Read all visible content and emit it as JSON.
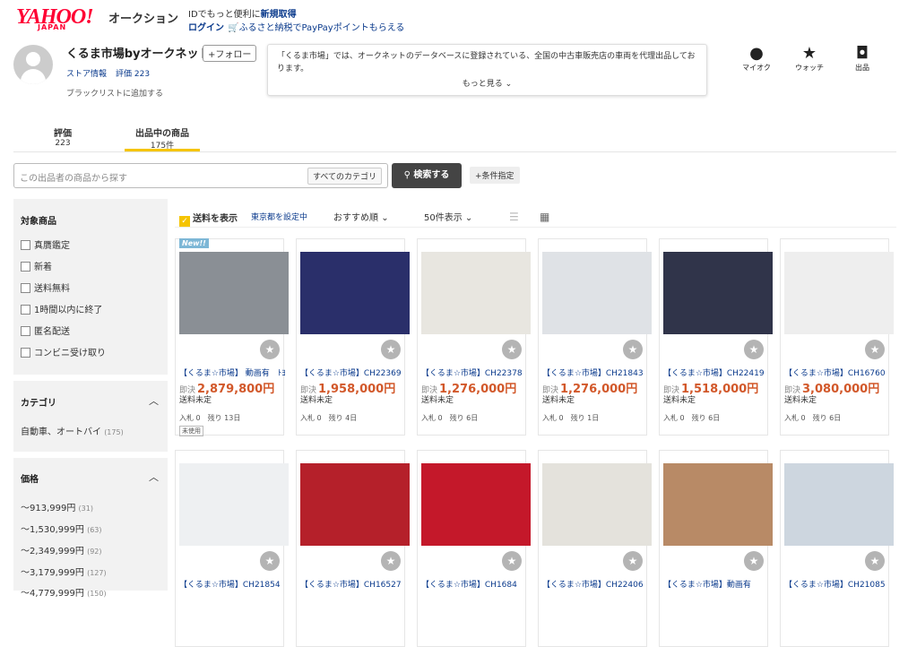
{
  "header": {
    "logo": "YAHOO!",
    "logo_sub": "JAPAN",
    "service": "オークション",
    "id_text": "IDでもっと便利に",
    "id_link": "新規取得",
    "login": "ログイン",
    "furusato": "ふるさと納税でPayPayポイントもらえる"
  },
  "seller": {
    "name": "くるま市場byオークネット",
    "follow": "+フォロー",
    "store_info": "ストア情報",
    "rating": "評価 223",
    "blacklist": "ブラックリストに追加する",
    "description": "「くるま市場」では、オークネットのデータベースに登録されている、全国の中古車販売店の車両を代理出品しております。",
    "more": "もっと見る"
  },
  "header_icons": [
    {
      "name": "マイオク",
      "icon": "user-icon"
    },
    {
      "name": "ウォッチ",
      "icon": "star-icon"
    },
    {
      "name": "出品",
      "icon": "camera-icon"
    }
  ],
  "tabs": [
    {
      "label": "評価",
      "count": "223"
    },
    {
      "label": "出品中の商品",
      "count": "175件"
    }
  ],
  "search": {
    "placeholder": "この出品者の商品から探す",
    "category": "すべてのカテゴリ",
    "button": "検索する",
    "conditions": "+条件指定"
  },
  "sidebar": {
    "target_title": "対象商品",
    "checks": [
      "真贋鑑定",
      "新着",
      "送料無料",
      "1時間以内に終了",
      "匿名配送",
      "コンビニ受け取り"
    ],
    "category_title": "カテゴリ",
    "category_item": "自動車、オートバイ",
    "category_count": "(175)",
    "price_title": "価格",
    "prices": [
      {
        "label": "～913,999円",
        "count": "(31)"
      },
      {
        "label": "～1,530,999円",
        "count": "(63)"
      },
      {
        "label": "～2,349,999円",
        "count": "(92)"
      },
      {
        "label": "～3,179,999円",
        "count": "(127)"
      },
      {
        "label": "～4,779,999円",
        "count": "(150)"
      }
    ]
  },
  "toolbar": {
    "shipping": "送料を表示",
    "tokyo": "東京都を設定中",
    "sort": "おすすめ順",
    "per_page": "50件表示"
  },
  "items_row1": [
    {
      "title": "【くるま☆市場】 動画有　ﾄﾖﾀ",
      "price": "2,879,800円",
      "ship": "送料未定",
      "bids": "入札 0",
      "left": "残り 13日",
      "used": "未使用",
      "new": "New!!",
      "color": "#8a8f95"
    },
    {
      "title": "【くるま☆市場】CH22369",
      "price": "1,958,000円",
      "ship": "送料未定",
      "bids": "入札 0",
      "left": "残り 4日",
      "color": "#2a2f6a"
    },
    {
      "title": "【くるま☆市場】CH22378",
      "price": "1,276,000円",
      "ship": "送料未定",
      "bids": "入札 0",
      "left": "残り 6日",
      "color": "#e8e6e0"
    },
    {
      "title": "【くるま☆市場】CH21843",
      "price": "1,276,000円",
      "ship": "送料未定",
      "bids": "入札 0",
      "left": "残り 1日",
      "color": "#dfe2e6"
    },
    {
      "title": "【くるま☆市場】CH22419",
      "price": "1,518,000円",
      "ship": "送料未定",
      "bids": "入札 0",
      "left": "残り 6日",
      "color": "#30344a"
    },
    {
      "title": "【くるま☆市場】CH16760",
      "price": "3,080,000円",
      "ship": "送料未定",
      "bids": "入札 0",
      "left": "残り 6日",
      "color": "#eeeeee"
    }
  ],
  "items_row2": [
    {
      "title": "【くるま☆市場】CH21854",
      "color": "#eef0f2"
    },
    {
      "title": "【くるま☆市場】CH16527",
      "color": "#b5202a"
    },
    {
      "title": "【くるま☆市場】CH1684",
      "color": "#c4182a"
    },
    {
      "title": "【くるま☆市場】CH22406",
      "color": "#e4e2dc"
    },
    {
      "title": "【くるま☆市場】動画有",
      "color": "#b88a66"
    },
    {
      "title": "【くるま☆市場】CH21085",
      "color": "#cdd6df"
    }
  ],
  "sokketsu": "即決"
}
